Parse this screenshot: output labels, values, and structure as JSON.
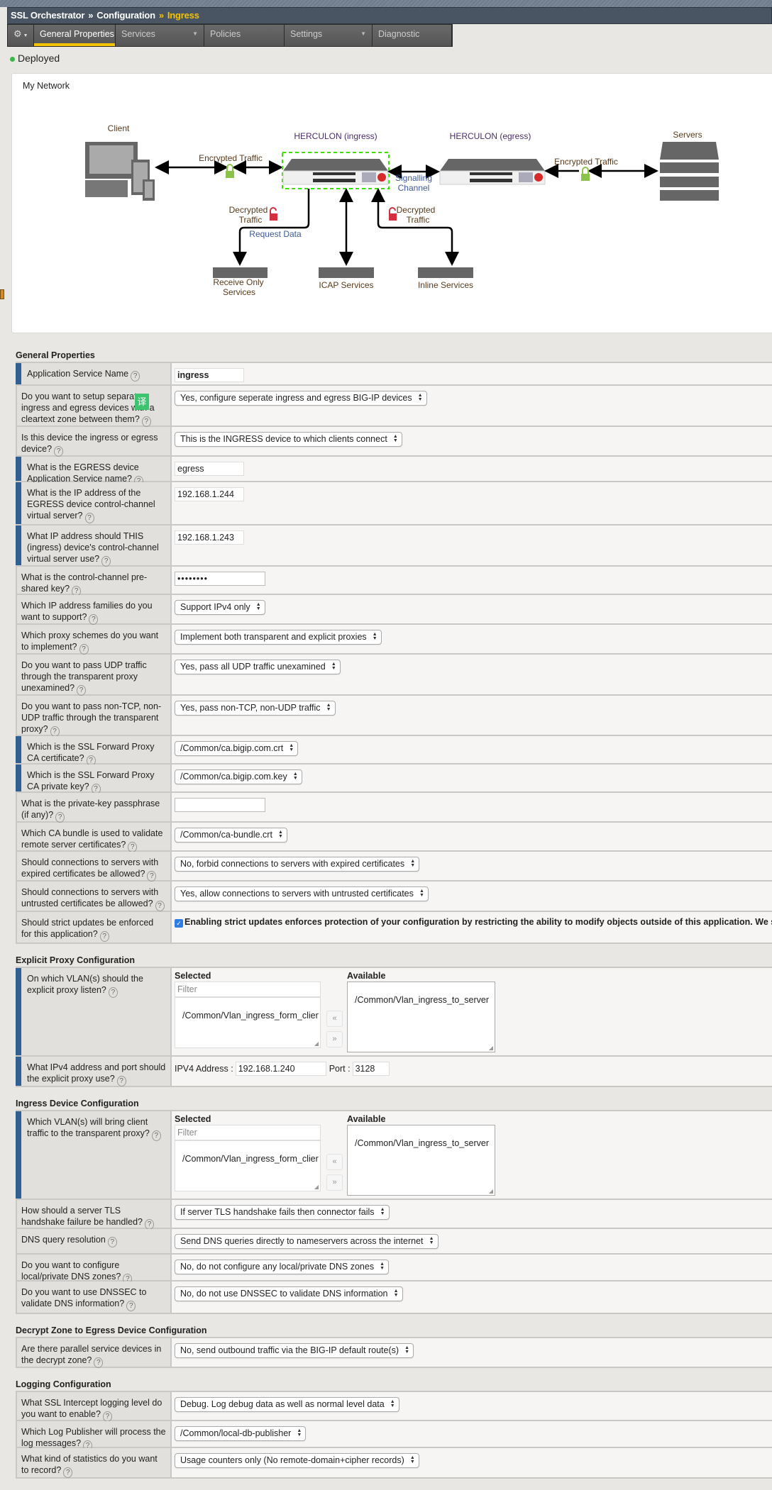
{
  "breadcrumb": {
    "items": [
      "SSL Orchestrator",
      "Configuration"
    ],
    "current": "Ingress",
    "separator": "»"
  },
  "tabs": [
    {
      "label": "General Properties",
      "active": true,
      "dropdown": false
    },
    {
      "label": "Services",
      "active": false,
      "dropdown": true
    },
    {
      "label": "Policies",
      "active": false,
      "dropdown": false
    },
    {
      "label": "Settings",
      "active": false,
      "dropdown": true
    },
    {
      "label": "Diagnostic",
      "active": false,
      "dropdown": false
    }
  ],
  "status": {
    "text": "Deployed",
    "color": "#3cb648"
  },
  "network": {
    "title": "My Network",
    "labels": {
      "client": "Client",
      "ingress": "HERCULON (ingress)",
      "egress": "HERCULON (egress)",
      "servers": "Servers",
      "enc_left": "Encrypted Traffic",
      "enc_right": "Encrypted Traffic",
      "signalling_1": "Signalling",
      "signalling_2": "Channel",
      "dec_left_1": "Decrypted",
      "dec_left_2": "Traffic",
      "dec_right_1": "Decrypted",
      "dec_right_2": "Traffic",
      "request_data": "Request Data",
      "receive_1": "Receive Only",
      "receive_2": "Services",
      "icap": "ICAP Services",
      "inline": "Inline Services"
    }
  },
  "translate_badge": "译",
  "sections": [
    {
      "title": "General Properties",
      "rows": [
        {
          "label": "Application Service Name",
          "mark": true,
          "control": {
            "type": "input",
            "value": "ingress",
            "bold": true
          }
        },
        {
          "label": "Do you want to setup separate ingress and egress devices with a cleartext zone between them?",
          "control": {
            "type": "select",
            "value": "Yes, configure seperate ingress and egress BIG-IP devices"
          }
        },
        {
          "label": "Is this device the ingress or egress device?",
          "control": {
            "type": "select",
            "value": "This is the INGRESS device to which clients connect"
          }
        },
        {
          "label": "What is the EGRESS device Application Service name?",
          "mark": true,
          "control": {
            "type": "input",
            "value": "egress"
          }
        },
        {
          "label": "What is the IP address of the EGRESS device control-channel virtual server?",
          "mark": true,
          "control": {
            "type": "input",
            "value": "192.168.1.244"
          }
        },
        {
          "label": "What IP address should THIS (ingress) device's control-channel virtual server use?",
          "mark": true,
          "control": {
            "type": "input",
            "value": "192.168.1.243"
          }
        },
        {
          "label": "What is the control-channel pre-shared key?",
          "control": {
            "type": "password",
            "value": "••••••••"
          }
        },
        {
          "label": "Which IP address families do you want to support?",
          "control": {
            "type": "select",
            "value": "Support IPv4 only"
          }
        },
        {
          "label": "Which proxy schemes do you want to implement?",
          "control": {
            "type": "select",
            "value": "Implement both transparent and explicit proxies"
          }
        },
        {
          "label": "Do you want to pass UDP traffic through the transparent proxy unexamined?",
          "control": {
            "type": "select",
            "value": "Yes, pass all UDP traffic unexamined"
          }
        },
        {
          "label": "Do you want to pass non-TCP, non-UDP traffic through the transparent proxy?",
          "control": {
            "type": "select",
            "value": "Yes, pass non-TCP, non-UDP traffic"
          }
        },
        {
          "label": "Which is the SSL Forward Proxy CA certificate?",
          "mark": true,
          "control": {
            "type": "select",
            "value": "/Common/ca.bigip.com.crt"
          }
        },
        {
          "label": "Which is the SSL Forward Proxy CA private key?",
          "mark": true,
          "control": {
            "type": "select",
            "value": "/Common/ca.bigip.com.key"
          }
        },
        {
          "label": "What is the private-key passphrase (if any)?",
          "control": {
            "type": "password",
            "value": ""
          }
        },
        {
          "label": "Which CA bundle is used to validate remote server certificates?",
          "control": {
            "type": "select",
            "value": "/Common/ca-bundle.crt"
          }
        },
        {
          "label": "Should connections to servers with expired certificates be allowed?",
          "control": {
            "type": "select",
            "value": "No, forbid connections to servers with expired certificates"
          }
        },
        {
          "label": "Should connections to servers with untrusted certificates be allowed?",
          "control": {
            "type": "select",
            "value": "Yes, allow connections to servers with untrusted certificates"
          }
        },
        {
          "label": "Should strict updates be enforced for this application?",
          "control": {
            "type": "checkbox",
            "checked": true,
            "value": "Enabling strict updates enforces protection of your configuration by restricting the ability to modify objects outside of this application. We strong"
          }
        }
      ]
    },
    {
      "title": "Explicit Proxy Configuration",
      "rows": [
        {
          "label": "On which VLAN(s) should the explicit proxy listen?",
          "mark": true,
          "control": {
            "type": "dual",
            "selected_label": "Selected",
            "available_label": "Available",
            "filter_placeholder": "Filter",
            "selected": [
              "/Common/Vlan_ingress_form_clier"
            ],
            "available": [
              "/Common/Vlan_ingress_to_server"
            ],
            "add": "«",
            "remove": "»"
          }
        },
        {
          "label": "What IPv4 address and port should the explicit proxy use?",
          "mark": true,
          "control": {
            "type": "addrport",
            "addr_label": "IPV4 Address :",
            "addr": "192.168.1.240",
            "port_label": "Port :",
            "port": "3128"
          }
        }
      ]
    },
    {
      "title": "Ingress Device Configuration",
      "rows": [
        {
          "label": "Which VLAN(s) will bring client traffic to the transparent proxy?",
          "mark": true,
          "control": {
            "type": "dual",
            "selected_label": "Selected",
            "available_label": "Available",
            "filter_placeholder": "Filter",
            "selected": [
              "/Common/Vlan_ingress_form_clier"
            ],
            "available": [
              "/Common/Vlan_ingress_to_server"
            ],
            "add": "«",
            "remove": "»"
          }
        },
        {
          "label": "How should a server TLS handshake failure be handled?",
          "control": {
            "type": "select",
            "value": "If server TLS handshake fails then connector fails"
          }
        },
        {
          "label": "DNS query resolution",
          "control": {
            "type": "select",
            "value": "Send DNS queries directly to nameservers across the internet"
          }
        },
        {
          "label": "Do you want to configure local/private DNS zones?",
          "control": {
            "type": "select",
            "value": "No, do not configure any local/private DNS zones"
          }
        },
        {
          "label": "Do you want to use DNSSEC to validate DNS information?",
          "control": {
            "type": "select",
            "value": "No, do not use DNSSEC to validate DNS information"
          }
        }
      ]
    },
    {
      "title": "Decrypt Zone to Egress Device Configuration",
      "rows": [
        {
          "label": "Are there parallel service devices in the decrypt zone?",
          "control": {
            "type": "select",
            "value": "No, send outbound traffic via the BIG-IP default route(s)"
          }
        }
      ]
    },
    {
      "title": "Logging Configuration",
      "rows": [
        {
          "label": "What SSL Intercept logging level do you want to enable?",
          "control": {
            "type": "select",
            "value": "Debug. Log debug data as well as normal level data"
          }
        },
        {
          "label": "Which Log Publisher will process the log messages?",
          "control": {
            "type": "select",
            "value": "/Common/local-db-publisher"
          }
        },
        {
          "label": "What kind of statistics do you want to record?",
          "control": {
            "type": "select",
            "value": "Usage counters only (No remote-domain+cipher records)"
          }
        }
      ]
    }
  ]
}
